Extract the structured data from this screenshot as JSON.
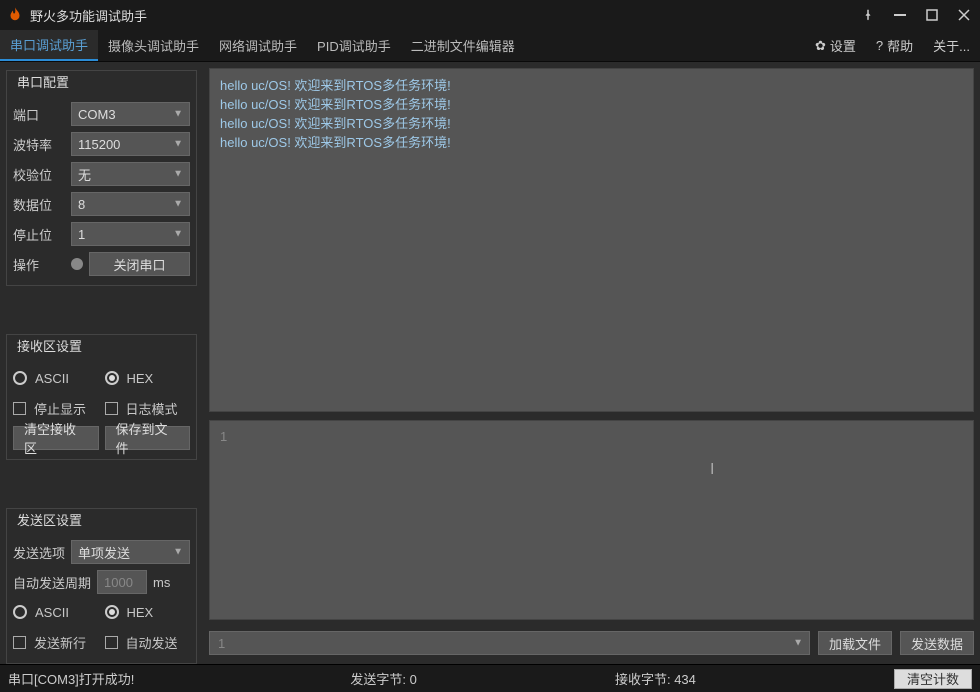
{
  "app": {
    "title": "野火多功能调试助手"
  },
  "tabs": {
    "items": [
      {
        "label": "串口调试助手",
        "active": true
      },
      {
        "label": "摄像头调试助手"
      },
      {
        "label": "网络调试助手"
      },
      {
        "label": "PID调试助手"
      },
      {
        "label": "二进制文件编辑器"
      }
    ],
    "settings": "设置",
    "help": "帮助",
    "about": "关于..."
  },
  "serial": {
    "group_title": "串口配置",
    "port_label": "端口",
    "port_value": "COM3",
    "baud_label": "波特率",
    "baud_value": "115200",
    "parity_label": "校验位",
    "parity_value": "无",
    "databits_label": "数据位",
    "databits_value": "8",
    "stopbits_label": "停止位",
    "stopbits_value": "1",
    "op_label": "操作",
    "close_btn": "关闭串口"
  },
  "recv": {
    "group_title": "接收区设置",
    "ascii": "ASCII",
    "hex": "HEX",
    "stop_display": "停止显示",
    "log_mode": "日志模式",
    "clear_btn": "清空接收区",
    "save_btn": "保存到文件"
  },
  "send": {
    "group_title": "发送区设置",
    "option_label": "发送选项",
    "option_value": "单项发送",
    "auto_period_label": "自动发送周期",
    "auto_period_value": "1000",
    "auto_period_unit": "ms",
    "ascii": "ASCII",
    "hex": "HEX",
    "send_newline": "发送新行",
    "auto_send": "自动发送"
  },
  "actions": {
    "load_file": "加载文件",
    "send_data": "发送数据",
    "combo_value": "1"
  },
  "output": {
    "lines": [
      "hello uc/OS! 欢迎来到RTOS多任务环境!",
      "hello uc/OS! 欢迎来到RTOS多任务环境!",
      "hello uc/OS! 欢迎来到RTOS多任务环境!",
      "hello uc/OS! 欢迎来到RTOS多任务环境!"
    ],
    "input_value": "1"
  },
  "status": {
    "msg": "串口[COM3]打开成功!",
    "tx_label": "发送字节: 0",
    "rx_label": "接收字节: 434",
    "clear": "清空计数"
  }
}
